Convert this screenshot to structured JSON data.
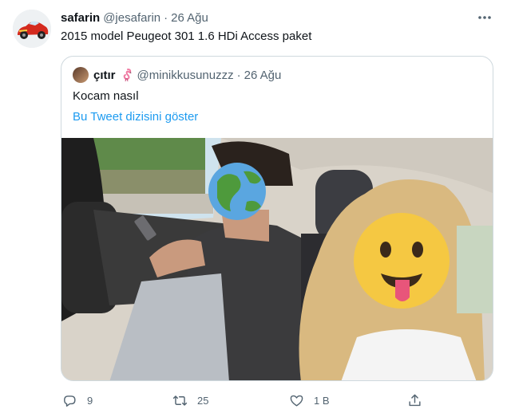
{
  "tweet": {
    "author_name": "safarin",
    "author_handle": "@jesafarin",
    "separator": "·",
    "date": "26 Ağu",
    "text": "2015 model Peugeot 301 1.6 HDi Access paket"
  },
  "quoted_tweet": {
    "author_name": "çıtır",
    "author_handle": "@minikkusunuzzz",
    "separator": "·",
    "date": "26 Ağu",
    "text": "Kocam nasıl",
    "thread_link": "Bu Tweet dizisini göster"
  },
  "actions": {
    "reply_count": "9",
    "retweet_count": "25",
    "like_count": "1 B"
  },
  "icons": {
    "more": "more-dots-icon",
    "reply": "reply-icon",
    "retweet": "retweet-icon",
    "like": "heart-icon",
    "share": "share-icon",
    "flamingo": "flamingo-emoji-icon"
  },
  "colors": {
    "link": "#1d9bf0",
    "secondary_text": "#536471",
    "border": "#cfd9de"
  }
}
